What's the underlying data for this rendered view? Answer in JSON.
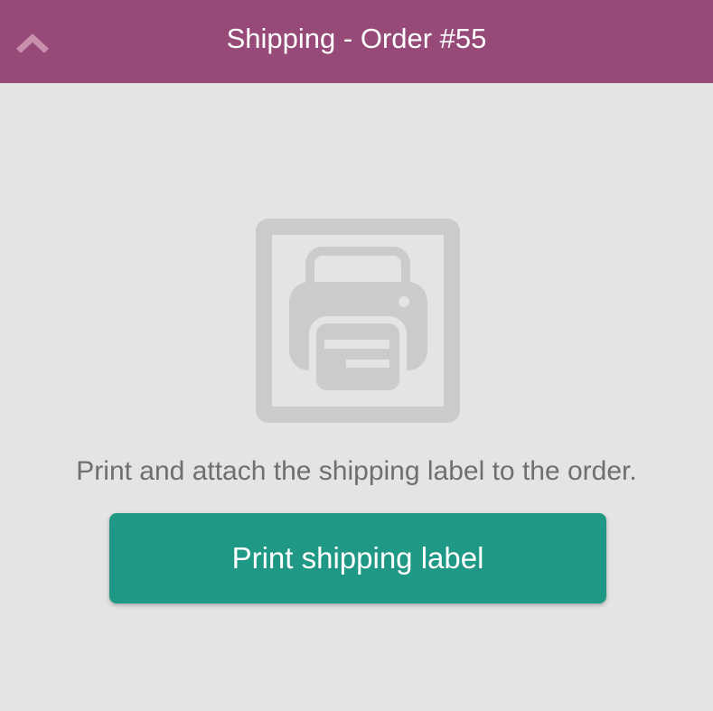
{
  "header": {
    "title": "Shipping - Order #55",
    "background_color": "#974a78",
    "back_icon": "chevron-up-icon"
  },
  "main": {
    "illustration_icon": "printer-icon",
    "instruction": "Print and attach the shipping label to the order.",
    "print_button_label": "Print shipping label",
    "print_button_color": "#1f9985"
  }
}
